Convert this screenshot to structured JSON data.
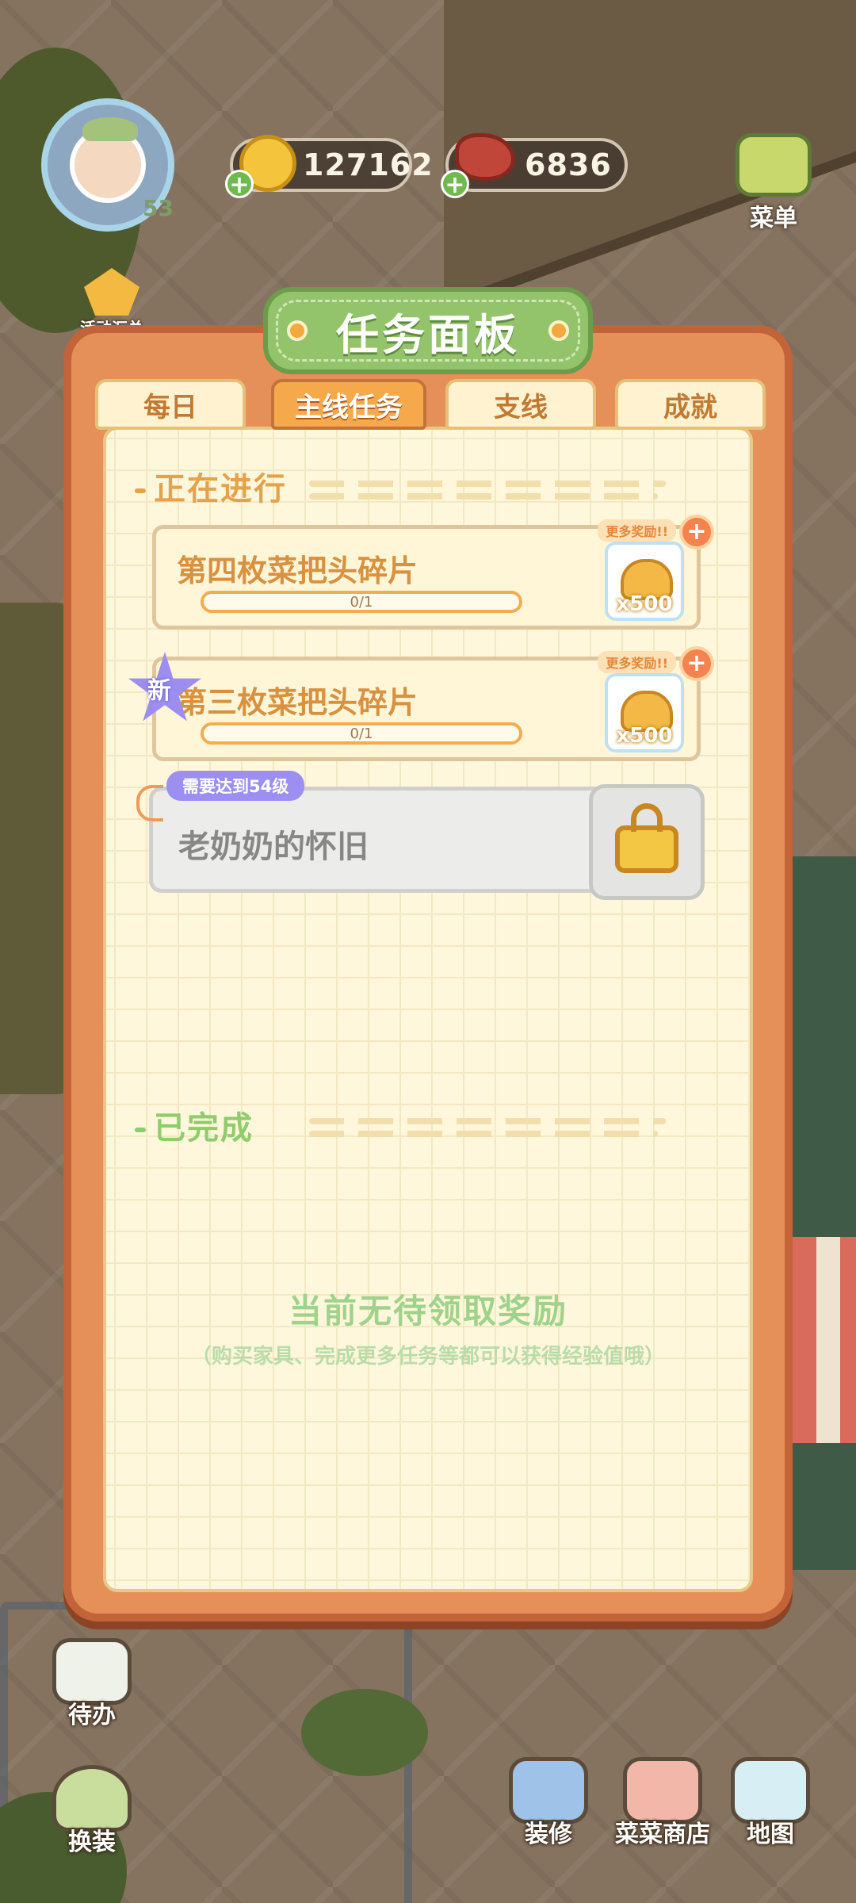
{
  "hud": {
    "level": "53",
    "coins": "127162",
    "meat": "6836",
    "menu_label": "菜单",
    "activity_label": "活动汇总"
  },
  "panel": {
    "title": "任务面板",
    "tabs": [
      {
        "label": "每日",
        "active": false
      },
      {
        "label": "主线任务",
        "active": true
      },
      {
        "label": "支线",
        "active": false
      },
      {
        "label": "成就",
        "active": false
      }
    ],
    "in_progress_label": "正在进行",
    "tasks": [
      {
        "name": "第四枚菜把头碎片",
        "progress": "0/1",
        "more_reward": "更多奖励!!",
        "reward_qty": "x500",
        "new": false
      },
      {
        "name": "第三枚菜把头碎片",
        "progress": "0/1",
        "more_reward": "更多奖励!!",
        "reward_qty": "x500",
        "new": true,
        "new_badge": "新"
      }
    ],
    "locked_task": {
      "name": "老奶奶的怀旧",
      "requirement": "需要达到54级"
    },
    "completed_label": "已完成",
    "empty_title": "当前无待领取奖励",
    "empty_sub": "（购买家具、完成更多任务等都可以获得经验值哦）"
  },
  "bottom_nav": {
    "todo": "待办",
    "dressup": "换装",
    "decorate": "装修",
    "shop": "菜菜商店",
    "map": "地图"
  }
}
